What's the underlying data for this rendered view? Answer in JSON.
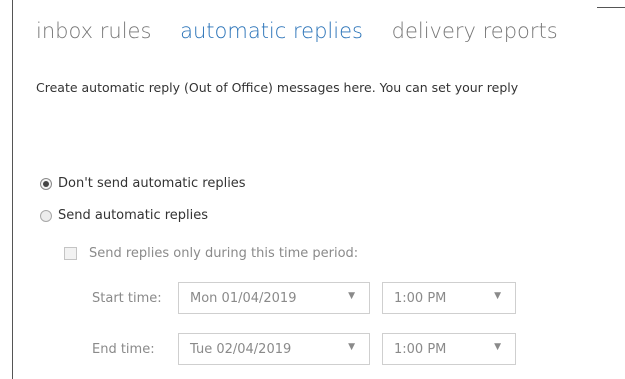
{
  "tabs": [
    {
      "label": "inbox rules",
      "active": false
    },
    {
      "label": "automatic replies",
      "active": true
    },
    {
      "label": "delivery reports",
      "active": false
    }
  ],
  "description": "Create automatic reply (Out of Office) messages here. You can set your reply",
  "options": {
    "dont_send": {
      "label": "Don't send automatic replies",
      "selected": true
    },
    "send": {
      "label": "Send automatic replies",
      "selected": false
    }
  },
  "time_period": {
    "label": "Send replies only during this time period:",
    "checked": false
  },
  "start": {
    "label": "Start time:",
    "date": "Mon 01/04/2019",
    "time": "1:00 PM"
  },
  "end": {
    "label": "End time:",
    "date": "Tue 02/04/2019",
    "time": "1:00 PM"
  },
  "colors": {
    "accent": "#2a73b8",
    "disabled_text": "#8a8a8a"
  },
  "icons": {
    "dropdown": "chevron-down-icon"
  }
}
